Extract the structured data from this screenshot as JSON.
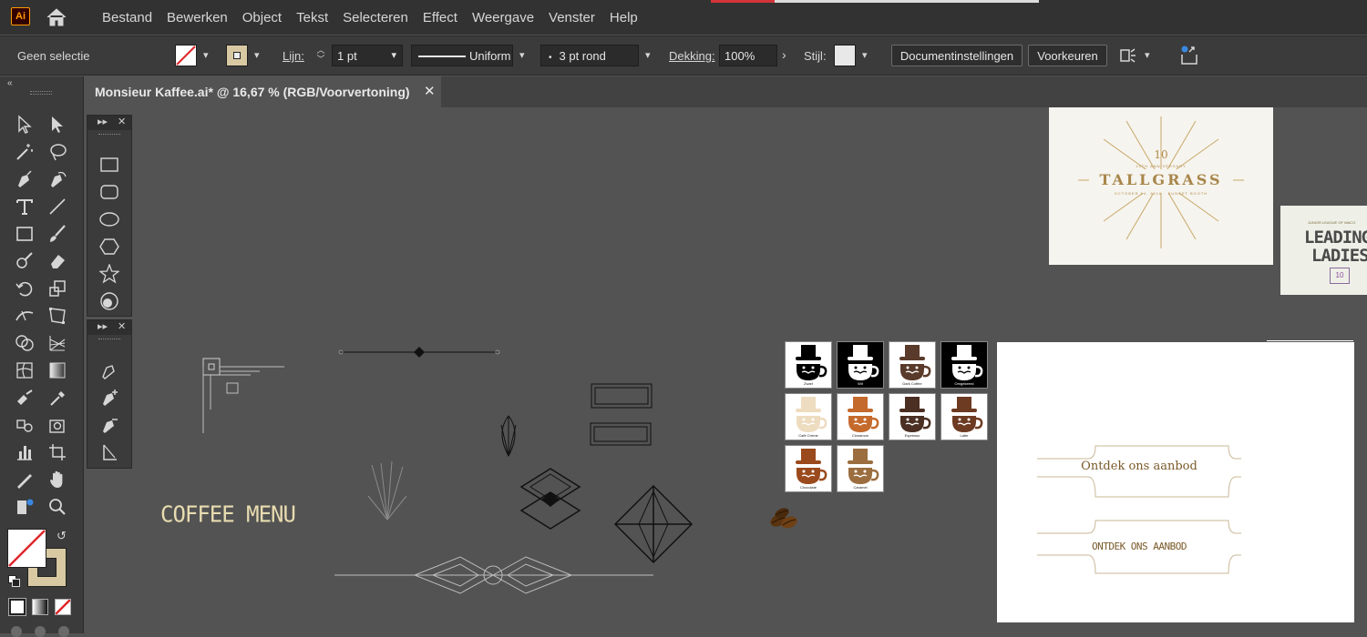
{
  "app": {
    "logo_text": "Ai"
  },
  "menu": {
    "items": [
      "Bestand",
      "Bewerken",
      "Object",
      "Tekst",
      "Selecteren",
      "Effect",
      "Weergave",
      "Venster",
      "Help"
    ]
  },
  "control": {
    "selection_status": "Geen selectie",
    "stroke_label": "Lijn:",
    "stroke_value": "1 pt",
    "profile_label": "Uniform",
    "brush_label": "3 pt rond",
    "opacity_label": "Dekking:",
    "opacity_value": "100%",
    "style_label": "Stijl:",
    "doc_settings_button": "Documentinstellingen",
    "preferences_button": "Voorkeuren",
    "fill_color": "#ffffff",
    "stroke_color": "#d8c9a3"
  },
  "tab": {
    "title": "Monsieur Kaffee.ai* @ 16,67 % (RGB/Voorvertoning)",
    "close": "✕"
  },
  "canvas": {
    "coffee_menu_text": "COFFEE MENU",
    "button1_text": "Ontdek ons aanbod",
    "button2_text": "ONTDEK ONS AANBOD",
    "tallgrass": {
      "title": "TALLGRASS",
      "number": "10",
      "subtitle": "10TH ANNIVERSARY",
      "date": "OCTOBER 14, 2016 · SUNSET BOOTH"
    },
    "leading_ladies": {
      "top": "JUNIOR LEAGUE OF WACO",
      "line1": "LEADING",
      "line2": "LADIES",
      "badge": "10"
    },
    "swatches": [
      {
        "label": "Zwart",
        "bg": "#ffffff",
        "hat": "#000000"
      },
      {
        "label": "Wit",
        "bg": "#000000",
        "hat": "#ffffff"
      },
      {
        "label": "Dark Coffee",
        "bg": "#ffffff",
        "hat": "#5a3a2a"
      },
      {
        "label": "Omgekeerd",
        "bg": "#000000",
        "hat": "#ffffff"
      },
      {
        "label": "Café Crème",
        "bg": "#ffffff",
        "hat": "#eddcbf"
      },
      {
        "label": "Cinnamon",
        "bg": "#ffffff",
        "hat": "#c46a2c"
      },
      {
        "label": "Espresso",
        "bg": "#ffffff",
        "hat": "#4a2f22"
      },
      {
        "label": "Latte",
        "bg": "#ffffff",
        "hat": "#6d3a22"
      },
      {
        "label": "Chocolate",
        "bg": "#ffffff",
        "hat": "#9a4a1c"
      },
      {
        "label": "Caramel",
        "bg": "#ffffff",
        "hat": "#9b6d3f"
      }
    ]
  },
  "icons": {
    "home": "home-icon",
    "close": "close-icon"
  }
}
